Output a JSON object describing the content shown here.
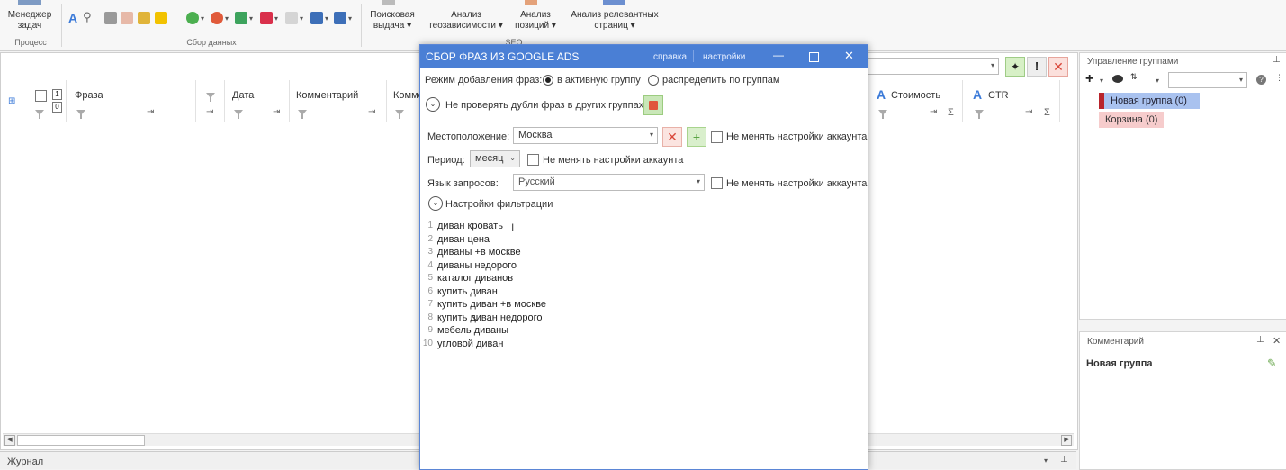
{
  "ribbon": {
    "manager_label_1": "Менеджер",
    "manager_label_2": "задач",
    "group_process": "Процесс",
    "group_data": "Сбор данных",
    "search_1": "Поисковая",
    "search_2": "выдача",
    "geo_1": "Анализ",
    "geo_2": "геозависимости",
    "pos_1": "Анализ",
    "pos_2": "позиций",
    "relevant_1": "Анализ релевантных",
    "relevant_2": "страниц",
    "group_seo": "SEO"
  },
  "grid": {
    "col_phrase": "Фраза",
    "col_date": "Дата",
    "col_comment": "Комментарий",
    "col_comment2": "Комме",
    "col_cost": "Стоимость",
    "col_ctr": "CTR",
    "num_1": "1",
    "num_0": "0"
  },
  "groups_panel": {
    "title": "Управление группами",
    "items": [
      {
        "label": "Новая группа (0)"
      },
      {
        "label": "Корзина (0)"
      }
    ]
  },
  "comment_panel": {
    "title": "Комментарий",
    "group_name": "Новая группа"
  },
  "journal": "Журнал",
  "dialog": {
    "title": "СБОР ФРАЗ ИЗ GOOGLE ADS",
    "help": "справка",
    "settings": "настройки",
    "mode_label": "Режим добавления фраз:",
    "mode_active": "в активную группу",
    "mode_distribute": "распределить по группам",
    "no_check_dupes": "Не проверять дубли фраз в других группах",
    "location_label": "Местоположение:",
    "location_value": "Москва",
    "dont_change_1": "Не менять настройки аккаунта",
    "period_label": "Период:",
    "period_value": "месяц",
    "dont_change_2": "Не менять настройки аккаунта",
    "language_label": "Язык запросов:",
    "language_value": "Русский",
    "dont_change_3": "Не менять настройки аккаунта",
    "filter_settings": "Настройки фильтрации",
    "phrases": [
      {
        "n": "1",
        "text": "диван кровать"
      },
      {
        "n": "2",
        "text": "диван цена"
      },
      {
        "n": "3",
        "text": "диваны +в москве"
      },
      {
        "n": "4",
        "text": "диваны недорого"
      },
      {
        "n": "5",
        "text": "каталог диванов"
      },
      {
        "n": "6",
        "text": "купить диван"
      },
      {
        "n": "7",
        "text": "купить диван +в москве"
      },
      {
        "n": "8",
        "text": "купить диван недорого"
      },
      {
        "n": "9",
        "text": "мебель диваны"
      },
      {
        "n": "10",
        "text": "угловой диван"
      }
    ]
  },
  "colors": {
    "dialog_title_bg": "#4a7fd5",
    "group_selected_bg": "#a9c2ef",
    "trash_group_bg": "#f6cccc",
    "ads_blue": "#3b7ad8"
  }
}
